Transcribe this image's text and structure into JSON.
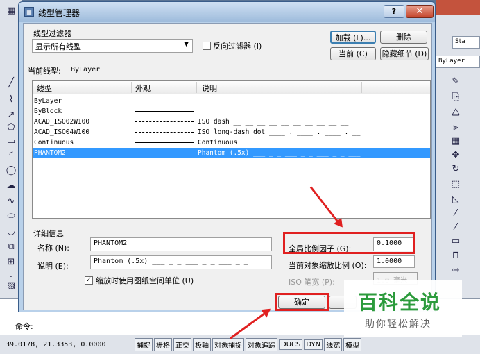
{
  "dialog": {
    "title": "线型管理器",
    "help_label": "?",
    "close_label": "✕",
    "filter_group_label": "线型过滤器",
    "filter_select": "显示所有线型",
    "invert_filter_label": "反向过滤器 (I)",
    "load_button": "加载 (L)...",
    "delete_button": "删除",
    "current_button": "当前 (C)",
    "hide_details_button": "隐藏细节 (D)",
    "current_linetype_label": "当前线型:",
    "current_linetype_value": "ByLayer",
    "columns": [
      "线型",
      "外观",
      "说明"
    ],
    "rows": [
      {
        "name": "ByLayer",
        "desc": ""
      },
      {
        "name": "ByBlock",
        "desc": ""
      },
      {
        "name": "ACAD_ISO02W100",
        "desc": "ISO dash __ __ __ __ __ __ __ __ __ __"
      },
      {
        "name": "ACAD_ISO04W100",
        "desc": "ISO long-dash dot ____ . ____ . ____ . __"
      },
      {
        "name": "Continuous",
        "desc": "Continuous"
      },
      {
        "name": "PHANTOM2",
        "desc": "Phantom (.5x) ___ _ _ ___ _ _ ___ _ _ ___"
      }
    ],
    "selected_row": 5,
    "details": {
      "group_label": "详细信息",
      "name_label": "名称 (N):",
      "name_value": "PHANTOM2",
      "desc_label": "说明 (E):",
      "desc_value": "Phantom (.5x) ___ _ _ ___ _ _ ___ _ _",
      "paper_units_label": "缩放时使用图纸空间单位 (U)",
      "global_scale_label": "全局比例因子 (G):",
      "global_scale_value": "0.1000",
      "object_scale_label": "当前对象缩放比例 (O):",
      "object_scale_value": "1.0000",
      "pen_width_label": "ISO 笔宽 (P):",
      "pen_width_value": "1.0 毫米"
    },
    "ok_button": "确定"
  },
  "cad": {
    "bylayer": "ByLayer",
    "style_label": "Sta",
    "command_label": "命令:",
    "coordinates": "39.0178, 21.3353, 0.0000",
    "status_buttons": [
      "捕捉",
      "栅格",
      "正交",
      "极轴",
      "对象捕捉",
      "对象追踪",
      "DUCS",
      "DYN",
      "线宽",
      "模型"
    ]
  },
  "watermark": {
    "title": "百科全说",
    "subtitle": "助你轻松解决"
  },
  "colors": {
    "selection": "#3399ff",
    "annotation_red": "#e02020",
    "watermark_green": "#2c9b3c"
  }
}
